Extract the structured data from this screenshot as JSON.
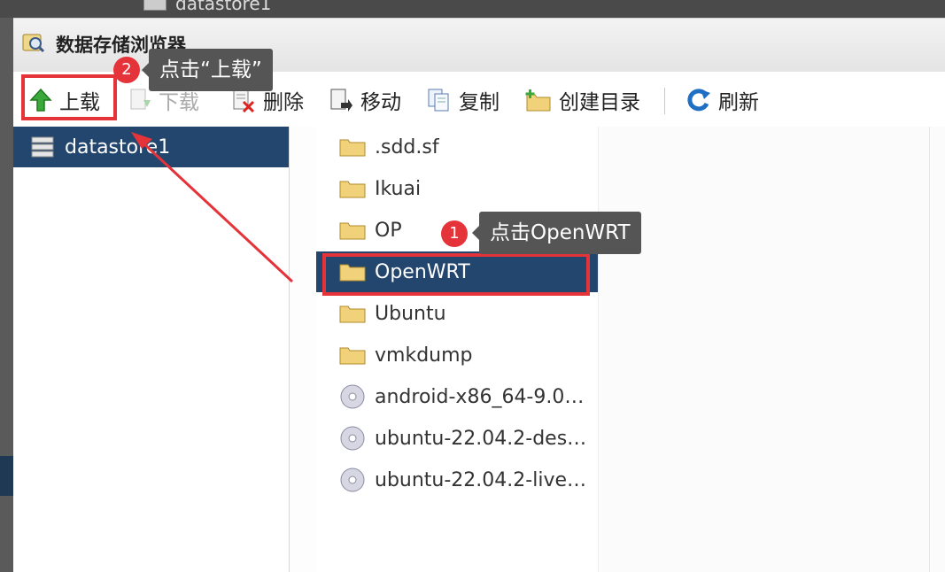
{
  "background": {
    "top_label": "datastore1"
  },
  "dialog": {
    "title": "数据存储浏览器"
  },
  "toolbar": {
    "upload": "上载",
    "download": "下载",
    "delete": "删除",
    "move": "移动",
    "copy": "复制",
    "create_dir": "创建目录",
    "refresh": "刷新"
  },
  "tree": {
    "items": [
      {
        "label": "datastore1"
      }
    ]
  },
  "files": [
    {
      "name": ".sdd.sf",
      "type": "folder"
    },
    {
      "name": "Ikuai",
      "type": "folder"
    },
    {
      "name": "OP",
      "type": "folder"
    },
    {
      "name": "OpenWRT",
      "type": "folder",
      "selected": true
    },
    {
      "name": "Ubuntu",
      "type": "folder"
    },
    {
      "name": "vmkdump",
      "type": "folder"
    },
    {
      "name": "android-x86_64-9.0…",
      "type": "disc"
    },
    {
      "name": "ubuntu-22.04.2-des…",
      "type": "disc"
    },
    {
      "name": "ubuntu-22.04.2-live…",
      "type": "disc"
    }
  ],
  "annotations": {
    "step1": {
      "badge": "1",
      "text": "点击OpenWRT"
    },
    "step2": {
      "badge": "2",
      "text": "点击“上载”"
    },
    "highlight_color": "#e5333a"
  }
}
